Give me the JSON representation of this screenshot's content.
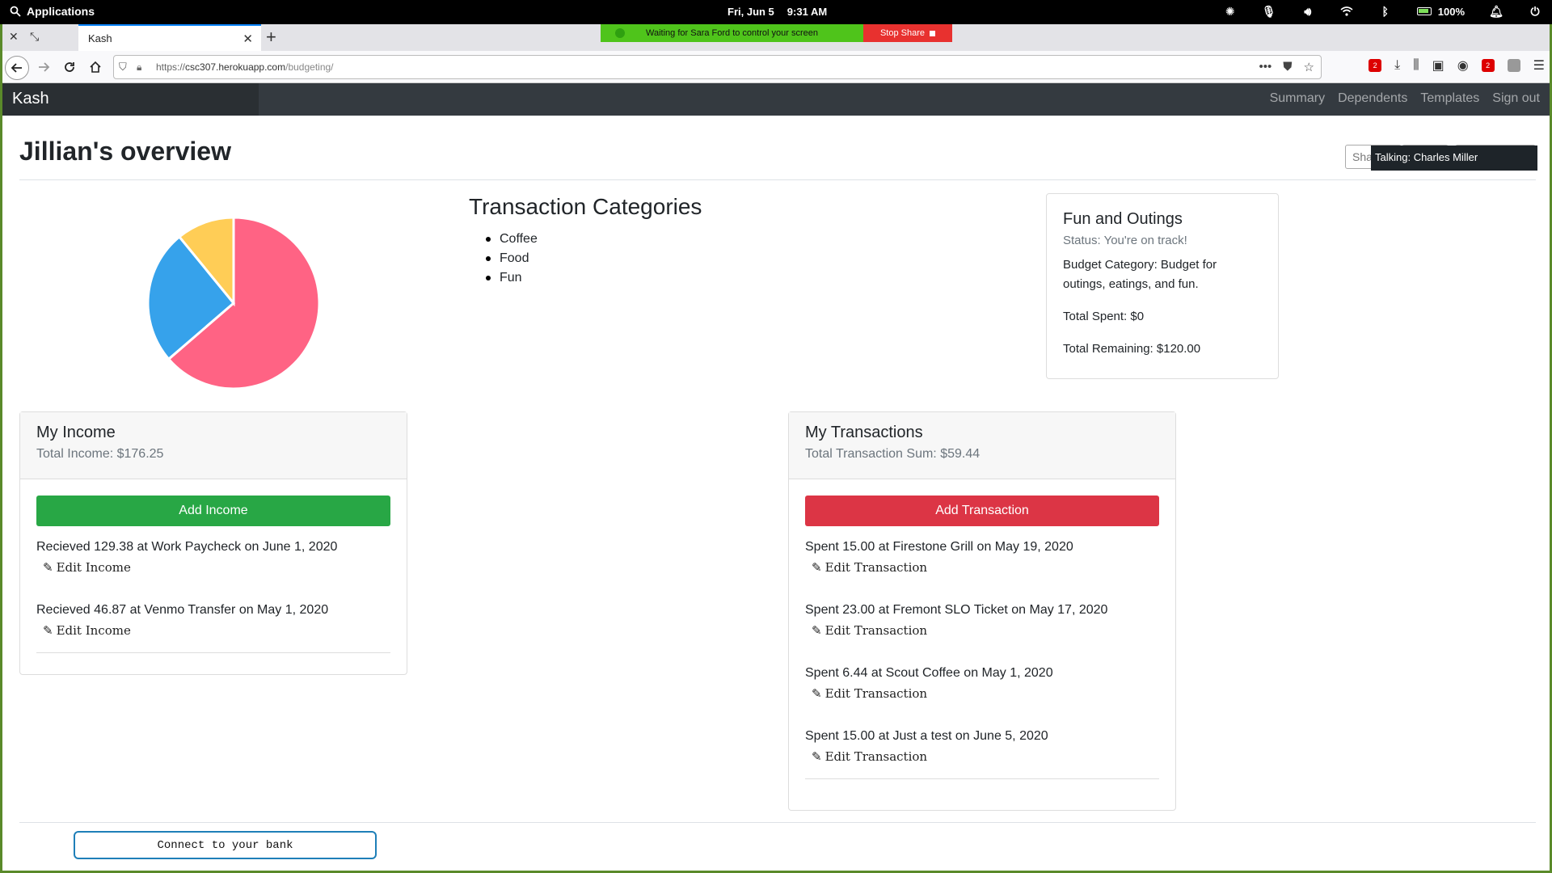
{
  "system": {
    "apps_label": "Applications",
    "date": "Fri, Jun  5",
    "time": "9:31 AM",
    "battery": "100%"
  },
  "browser": {
    "tab_title": "Kash",
    "url_prefix": "https://",
    "url_host": "csc307.herokuapp.com",
    "url_path": "/budgeting/",
    "share_banner": {
      "waiting_text": "Waiting for Sara Ford to control your screen",
      "stop_label": "Stop Share"
    },
    "ext_badge_1": "2",
    "ext_badge_2": "2"
  },
  "app": {
    "brand": "Kash",
    "nav": [
      "Summary",
      "Dependents",
      "Templates",
      "Sign out"
    ]
  },
  "page": {
    "title": "Jillian's overview",
    "share_placeholder": "Sha",
    "talking_tooltip": "Talking: Charles Miller"
  },
  "chart_data": {
    "type": "pie",
    "categories": [
      "Coffee",
      "Food",
      "Fun"
    ],
    "values": [
      37.59,
      15.0,
      6.44
    ],
    "colors": [
      "#ff6384",
      "#36a2eb",
      "#ffcd56"
    ]
  },
  "categories": {
    "title": "Transaction Categories",
    "items": [
      "Coffee",
      "Food",
      "Fun"
    ]
  },
  "budget_card": {
    "title": "Fun and Outings",
    "status": "Status: You're on track!",
    "description": "Budget Category: Budget for outings, eatings, and fun.",
    "total_spent": "Total Spent: $0",
    "total_remaining": "Total Remaining: $120.00"
  },
  "income": {
    "title": "My Income",
    "total": "Total Income: $176.25",
    "add_label": "Add Income",
    "entries": [
      {
        "text": "Recieved 129.38 at Work Paycheck on June 1, 2020",
        "edit": "Edit Income"
      },
      {
        "text": "Recieved 46.87 at Venmo Transfer on May 1, 2020",
        "edit": "Edit Income"
      }
    ]
  },
  "transactions": {
    "title": "My Transactions",
    "total": "Total Transaction Sum: $59.44",
    "add_label": "Add Transaction",
    "entries": [
      {
        "text": "Spent 15.00 at Firestone Grill on May 19, 2020",
        "edit": "Edit Transaction"
      },
      {
        "text": "Spent 23.00 at Fremont SLO Ticket on May 17, 2020",
        "edit": "Edit Transaction"
      },
      {
        "text": "Spent 6.44 at Scout Coffee on May 1, 2020",
        "edit": "Edit Transaction"
      },
      {
        "text": "Spent 15.00 at Just a test on June 5, 2020",
        "edit": "Edit Transaction"
      }
    ]
  },
  "bank_button": "Connect to your bank"
}
